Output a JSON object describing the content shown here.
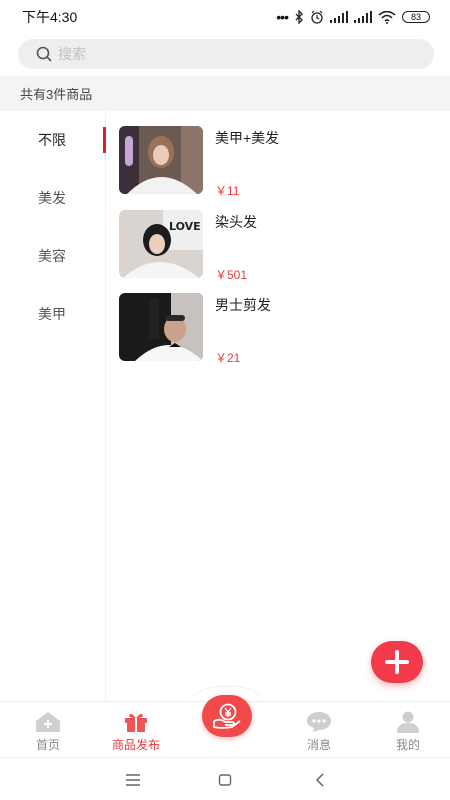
{
  "status_bar": {
    "time": "下午4:30",
    "signal_icons": "•••",
    "battery": "83"
  },
  "search": {
    "placeholder": "搜索",
    "value": ""
  },
  "summary": {
    "count_text": "共有3件商品"
  },
  "categories": [
    {
      "label": "不限",
      "active": true
    },
    {
      "label": "美发",
      "active": false
    },
    {
      "label": "美容",
      "active": false
    },
    {
      "label": "美甲",
      "active": false
    }
  ],
  "products": [
    {
      "name": "美甲+美发",
      "price": "￥11",
      "thumb_icon": "salon-photo-1"
    },
    {
      "name": "染头发",
      "price": "￥501",
      "thumb_icon": "salon-photo-2"
    },
    {
      "name": "男士剪发",
      "price": "￥21",
      "thumb_icon": "salon-photo-3"
    }
  ],
  "tabbar": {
    "tabs": [
      {
        "label": "首页",
        "icon": "home-add-icon",
        "active": false
      },
      {
        "label": "商品发布",
        "icon": "gift-icon",
        "active": true
      },
      {
        "label": "消息",
        "icon": "chat-icon",
        "active": false
      },
      {
        "label": "我的",
        "icon": "user-icon",
        "active": false
      }
    ],
    "center_icon": "yuan-hand-icon"
  },
  "colors": {
    "accent": "#e83a3a",
    "fab": "#f23a4a",
    "background_bar": "#f4f4f4"
  }
}
